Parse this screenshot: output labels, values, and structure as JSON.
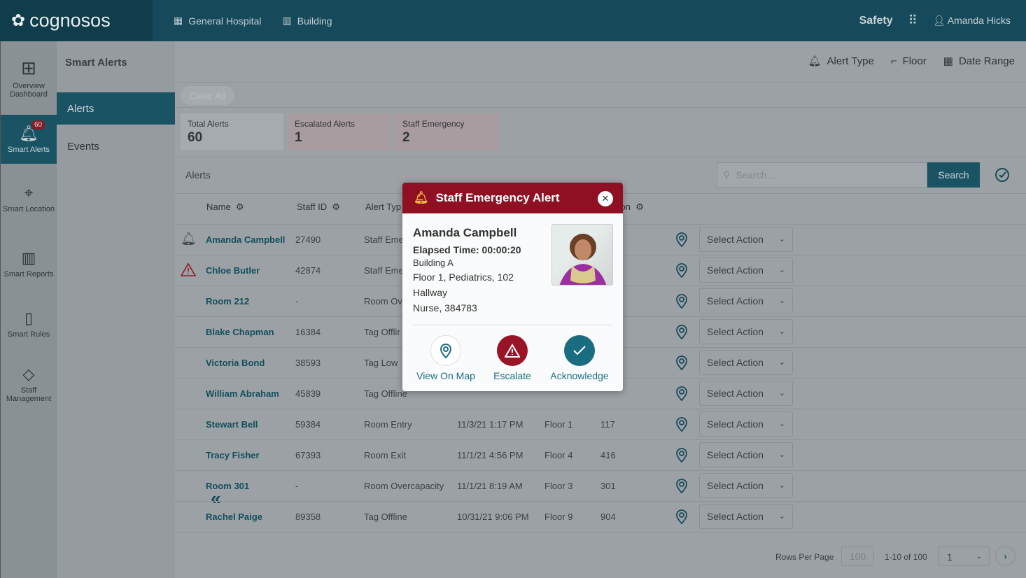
{
  "header": {
    "logo": "cognosos",
    "hospital": "General Hospital",
    "building": "Building",
    "module": "Safety",
    "user": "Amanda Hicks"
  },
  "sidebar": {
    "items": [
      {
        "label": "Overview Dashboard",
        "icon": "layout-icon"
      },
      {
        "label": "Smart Alerts",
        "icon": "bell-icon",
        "badge": "60"
      },
      {
        "label": "Smart Location",
        "icon": "pin-icon"
      },
      {
        "label": "Smart Reports",
        "icon": "chart-icon"
      },
      {
        "label": "Smart Rules",
        "icon": "sd-card-icon"
      },
      {
        "label": "Staff Management",
        "icon": "tag-icon"
      }
    ]
  },
  "subnav": {
    "title": "Smart Alerts",
    "items": [
      "Alerts",
      "Events"
    ]
  },
  "filters": {
    "alert_type": "Alert Type",
    "floor": "Floor",
    "date_range": "Date Range",
    "clear_all": "Clear All"
  },
  "summary": [
    {
      "label": "Total Alerts",
      "value": "60"
    },
    {
      "label": "Escalated Alerts",
      "value": "1"
    },
    {
      "label": "Staff Emergency",
      "value": "2"
    }
  ],
  "table": {
    "title": "Alerts",
    "search_placeholder": "Search...",
    "search_button": "Search",
    "columns": [
      "Name",
      "Staff ID",
      "Alert Typ",
      "tion"
    ],
    "action_placeholder": "Select Action",
    "rows": [
      {
        "icon": "bell",
        "name": "Amanda Campbell",
        "id": "27490",
        "type": "Staff Eme",
        "date": "",
        "floor": "",
        "room": ""
      },
      {
        "icon": "warning",
        "name": "Chloe Butler",
        "id": "42874",
        "type": "Staff Eme",
        "date": "",
        "floor": "",
        "room": ""
      },
      {
        "icon": "",
        "name": "Room 212",
        "id": "-",
        "type": "Room Ov",
        "date": "",
        "floor": "",
        "room": ""
      },
      {
        "icon": "",
        "name": "Blake Chapman",
        "id": "16384",
        "type": "Tag Offlir",
        "date": "",
        "floor": "",
        "room": ""
      },
      {
        "icon": "",
        "name": "Victoria Bond",
        "id": "38593",
        "type": "Tag Low",
        "date": "",
        "floor": "",
        "room": ""
      },
      {
        "icon": "",
        "name": "William Abraham",
        "id": "45839",
        "type": "Tag Offline",
        "date": "",
        "floor": "",
        "room": ""
      },
      {
        "icon": "",
        "name": "Stewart Bell",
        "id": "59384",
        "type": "Room Entry",
        "date": "11/3/21 1:17 PM",
        "floor": "Floor 1",
        "room": "117"
      },
      {
        "icon": "",
        "name": "Tracy Fisher",
        "id": "67393",
        "type": "Room Exit",
        "date": "11/1/21 4:56 PM",
        "floor": "Floor 4",
        "room": "416"
      },
      {
        "icon": "",
        "name": "Room 301",
        "id": "-",
        "type": "Room Overcapacity",
        "date": "11/1/21 8:19 AM",
        "floor": "Floor 3",
        "room": "301"
      },
      {
        "icon": "",
        "name": "Rachel Paige",
        "id": "89358",
        "type": "Tag Offline",
        "date": "10/31/21 9:06 PM",
        "floor": "Floor 9",
        "room": "904"
      }
    ]
  },
  "pagination": {
    "rows_per_page_label": "Rows Per Page",
    "rows_per_page": "100",
    "range": "1-10 of 100",
    "page": "1"
  },
  "modal": {
    "title": "Staff Emergency Alert",
    "name": "Amanda Campbell",
    "elapsed": "Elapsed Time: 00:00:20",
    "building": "Building A",
    "location": "Floor 1, Pediatrics, 102",
    "area": "Hallway",
    "role": "Nurse, 384783",
    "actions": [
      "View On Map",
      "Escalate",
      "Acknowledge"
    ],
    "colors": {
      "header": "#8e1022",
      "escalate": "#9a1428",
      "acknowledge": "#1a6d80"
    }
  }
}
